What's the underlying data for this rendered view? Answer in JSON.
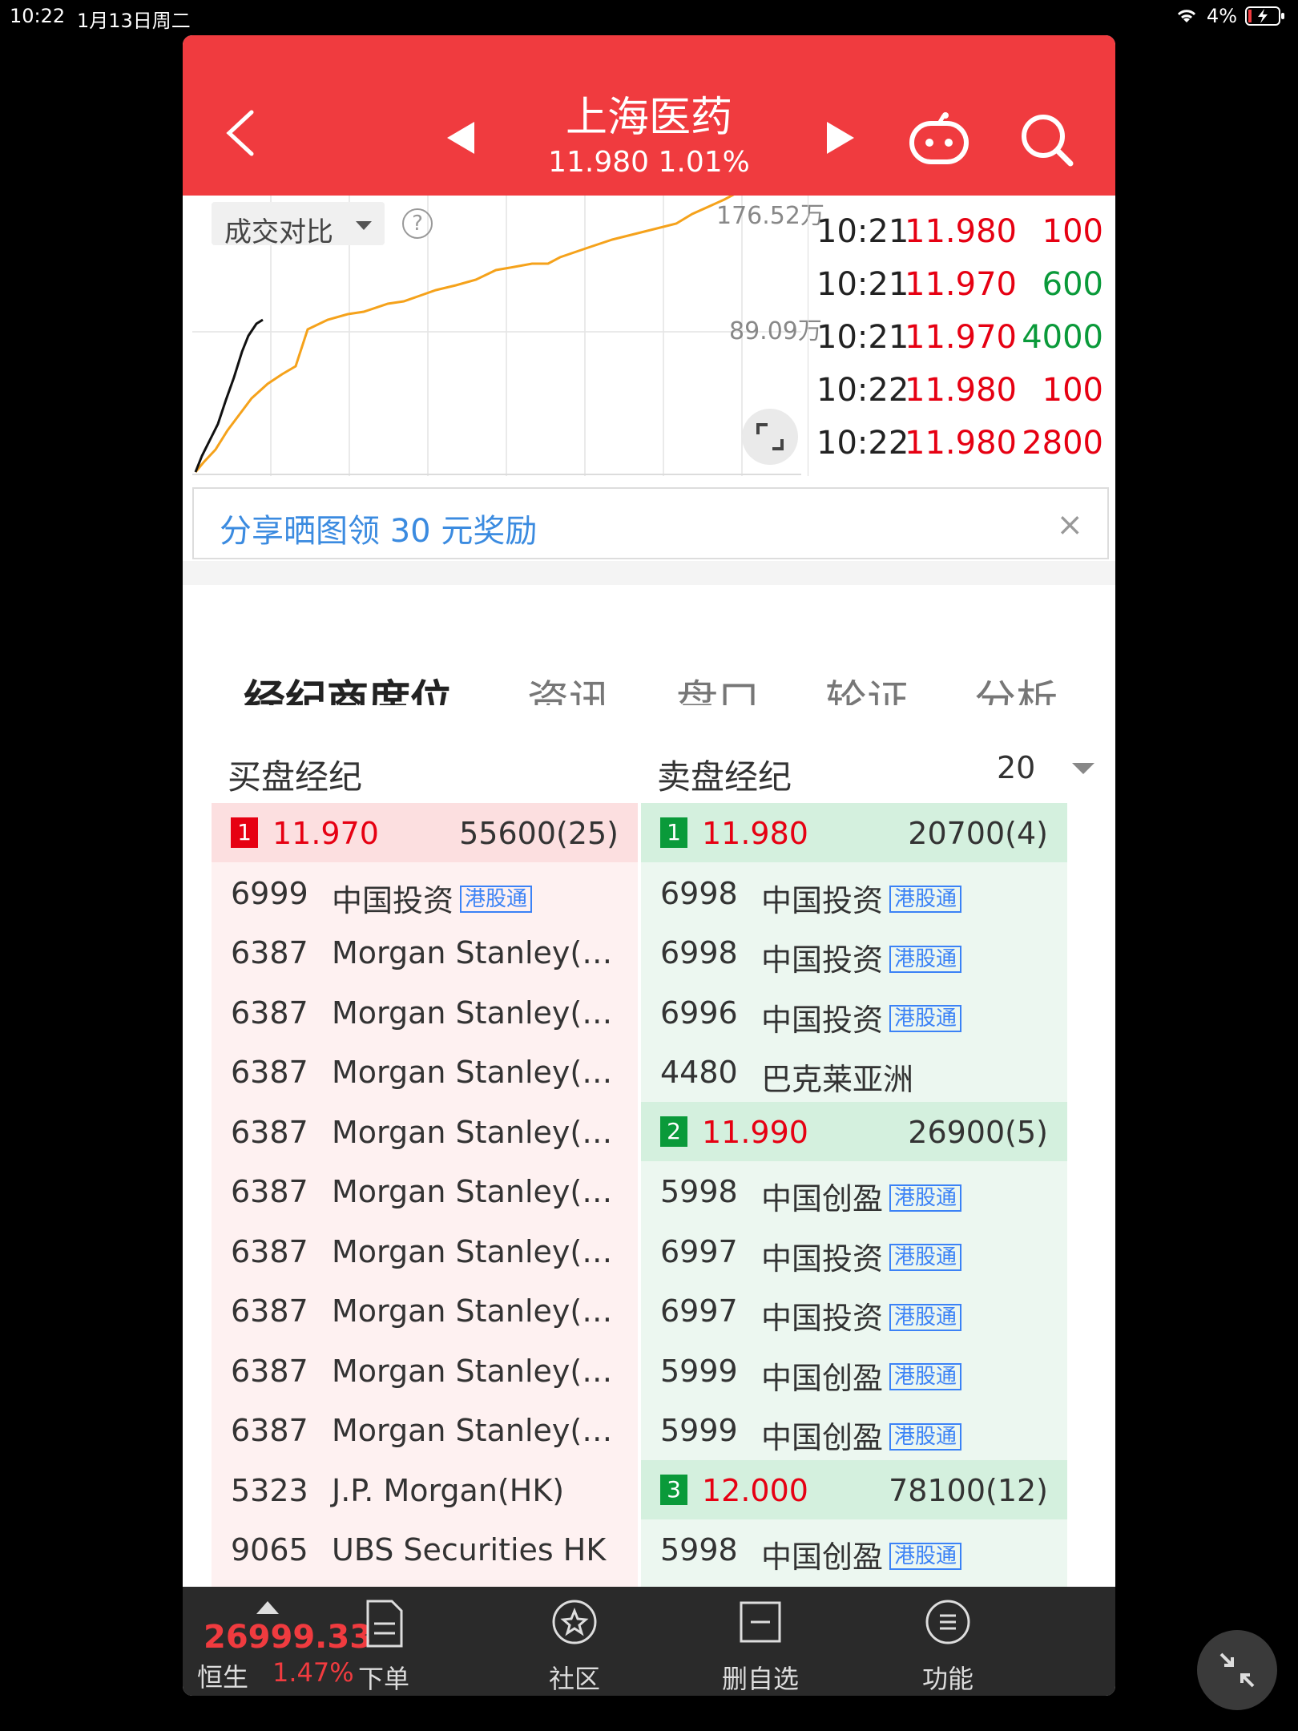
{
  "status_bar": {
    "time": "10:22",
    "date": "1月13日周二",
    "battery": "4%"
  },
  "header": {
    "title": "上海医药",
    "subtitle": "11.980 1.01%"
  },
  "chart": {
    "compare_label": "成交对比",
    "help": "?",
    "vol_top": "176.52万",
    "vol_mid": "89.09万"
  },
  "chart_data": {
    "type": "line",
    "y_labels": [
      "176.52万",
      "89.09万"
    ],
    "series": [
      {
        "color": "#f5a21b",
        "values": [
          [
            0,
            0
          ],
          [
            10,
            12
          ],
          [
            25,
            28
          ],
          [
            40,
            52
          ],
          [
            55,
            72
          ],
          [
            70,
            92
          ],
          [
            90,
            110
          ],
          [
            108,
            122
          ],
          [
            125,
            132
          ],
          [
            140,
            178
          ],
          [
            165,
            190
          ],
          [
            190,
            197
          ],
          [
            210,
            200
          ],
          [
            240,
            210
          ],
          [
            260,
            213
          ],
          [
            280,
            220
          ],
          [
            300,
            227
          ],
          [
            325,
            233
          ],
          [
            350,
            240
          ],
          [
            375,
            252
          ],
          [
            398,
            256
          ],
          [
            420,
            260
          ],
          [
            440,
            260
          ],
          [
            455,
            268
          ],
          [
            490,
            280
          ],
          [
            520,
            290
          ],
          [
            560,
            300
          ],
          [
            600,
            310
          ],
          [
            620,
            322
          ],
          [
            660,
            340
          ],
          [
            690,
            356
          ],
          [
            712,
            372
          ]
        ]
      },
      {
        "color": "#111111",
        "values": [
          [
            0,
            0
          ],
          [
            8,
            20
          ],
          [
            18,
            40
          ],
          [
            28,
            60
          ],
          [
            38,
            90
          ],
          [
            48,
            118
          ],
          [
            58,
            150
          ],
          [
            66,
            170
          ],
          [
            76,
            185
          ],
          [
            84,
            190
          ]
        ]
      }
    ]
  },
  "trades": [
    {
      "time": "10:21",
      "price": "11.980",
      "vol": "100",
      "dir": "up"
    },
    {
      "time": "10:21",
      "price": "11.970",
      "vol": "600",
      "dir": "down"
    },
    {
      "time": "10:21",
      "price": "11.970",
      "vol": "4000",
      "dir": "down"
    },
    {
      "time": "10:22",
      "price": "11.980",
      "vol": "100",
      "dir": "up"
    },
    {
      "time": "10:22",
      "price": "11.980",
      "vol": "2800",
      "dir": "up"
    }
  ],
  "banner": {
    "text": "分享晒图领 30 元奖励",
    "close": "×"
  },
  "tabs": [
    "经纪商席位",
    "资讯",
    "盘口",
    "轮证",
    "分析"
  ],
  "brokers": {
    "buy_header": "买盘经纪",
    "sell_header": "卖盘经纪",
    "depth": "20",
    "buy": [
      {
        "type": "level",
        "level": "1",
        "price": "11.970",
        "vol": "55600(25)"
      },
      {
        "code": "6999",
        "name": "中国投资",
        "tag": "港股通"
      },
      {
        "code": "6387",
        "name": "Morgan Stanley(…"
      },
      {
        "code": "6387",
        "name": "Morgan Stanley(…"
      },
      {
        "code": "6387",
        "name": "Morgan Stanley(…"
      },
      {
        "code": "6387",
        "name": "Morgan Stanley(…"
      },
      {
        "code": "6387",
        "name": "Morgan Stanley(…"
      },
      {
        "code": "6387",
        "name": "Morgan Stanley(…"
      },
      {
        "code": "6387",
        "name": "Morgan Stanley(…"
      },
      {
        "code": "6387",
        "name": "Morgan Stanley(…"
      },
      {
        "code": "6387",
        "name": "Morgan Stanley(…"
      },
      {
        "code": "5323",
        "name": "J.P. Morgan(HK)"
      },
      {
        "code": "9065",
        "name": "UBS Securities HK"
      }
    ],
    "sell": [
      {
        "type": "level",
        "level": "1",
        "price": "11.980",
        "vol": "20700(4)"
      },
      {
        "code": "6998",
        "name": "中国投资",
        "tag": "港股通"
      },
      {
        "code": "6998",
        "name": "中国投资",
        "tag": "港股通"
      },
      {
        "code": "6996",
        "name": "中国投资",
        "tag": "港股通"
      },
      {
        "code": "4480",
        "name": "巴克莱亚洲"
      },
      {
        "type": "level",
        "level": "2",
        "price": "11.990",
        "vol": "26900(5)"
      },
      {
        "code": "5998",
        "name": "中国创盈",
        "tag": "港股通"
      },
      {
        "code": "6997",
        "name": "中国投资",
        "tag": "港股通"
      },
      {
        "code": "6997",
        "name": "中国投资",
        "tag": "港股通"
      },
      {
        "code": "5999",
        "name": "中国创盈",
        "tag": "港股通"
      },
      {
        "code": "5999",
        "name": "中国创盈",
        "tag": "港股通"
      },
      {
        "type": "level",
        "level": "3",
        "price": "12.000",
        "vol": "78100(12)"
      },
      {
        "code": "5998",
        "name": "中国创盈",
        "tag": "港股通"
      }
    ]
  },
  "bottom_bar": {
    "index_value": "26999.33",
    "index_name": "恒生",
    "index_pct": "1.47%",
    "items": [
      {
        "label": "下单",
        "icon": "order-icon"
      },
      {
        "label": "社区",
        "icon": "community-icon"
      },
      {
        "label": "删自选",
        "icon": "remove-watchlist-icon"
      },
      {
        "label": "功能",
        "icon": "menu-icon"
      }
    ]
  },
  "colors": {
    "header_red": "#f03b3f",
    "up_red": "#e60012",
    "down_green": "#0a9a3a",
    "volume_line": "#f5a21b"
  }
}
